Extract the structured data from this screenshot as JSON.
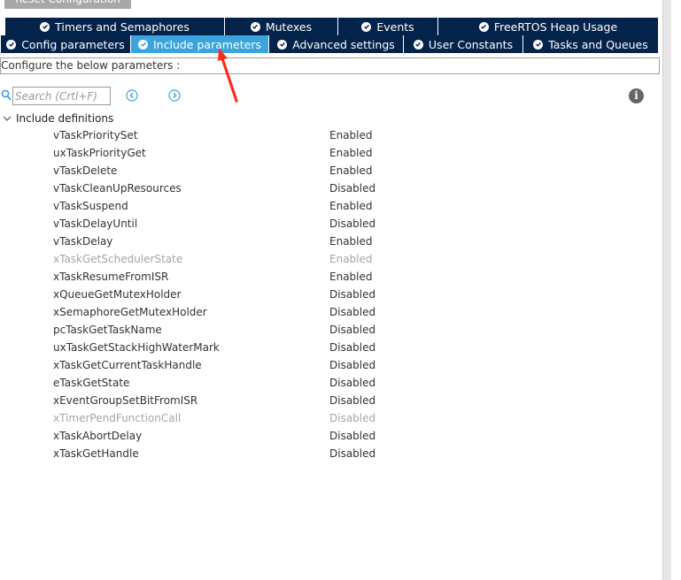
{
  "top_button": {
    "label": "Reset Configuration"
  },
  "tabs_row1": [
    {
      "label": "Timers and Semaphores",
      "active": false
    },
    {
      "label": "Mutexes",
      "active": false
    },
    {
      "label": "Events",
      "active": false
    },
    {
      "label": "FreeRTOS Heap Usage",
      "active": false
    }
  ],
  "tabs_row2": [
    {
      "label": "Config parameters",
      "active": false
    },
    {
      "label": "Include parameters",
      "active": true
    },
    {
      "label": "Advanced settings",
      "active": false
    },
    {
      "label": "User Constants",
      "active": false
    },
    {
      "label": "Tasks and Queues",
      "active": false
    }
  ],
  "section_label": "Configure the below parameters :",
  "search": {
    "placeholder": "Search (Crtl+F)",
    "value": ""
  },
  "info_icon": "i",
  "tree": {
    "group_label": "Include definitions",
    "expanded": true,
    "items": [
      {
        "name": "vTaskPrioritySet",
        "value": "Enabled",
        "dim": false
      },
      {
        "name": "uxTaskPriorityGet",
        "value": "Enabled",
        "dim": false
      },
      {
        "name": "vTaskDelete",
        "value": "Enabled",
        "dim": false
      },
      {
        "name": "vTaskCleanUpResources",
        "value": "Disabled",
        "dim": false
      },
      {
        "name": "vTaskSuspend",
        "value": "Enabled",
        "dim": false
      },
      {
        "name": "vTaskDelayUntil",
        "value": "Disabled",
        "dim": false
      },
      {
        "name": "vTaskDelay",
        "value": "Enabled",
        "dim": false
      },
      {
        "name": "xTaskGetSchedulerState",
        "value": "Enabled",
        "dim": true
      },
      {
        "name": "xTaskResumeFromISR",
        "value": "Enabled",
        "dim": false
      },
      {
        "name": "xQueueGetMutexHolder",
        "value": "Disabled",
        "dim": false
      },
      {
        "name": "xSemaphoreGetMutexHolder",
        "value": "Disabled",
        "dim": false
      },
      {
        "name": "pcTaskGetTaskName",
        "value": "Disabled",
        "dim": false
      },
      {
        "name": "uxTaskGetStackHighWaterMark",
        "value": "Disabled",
        "dim": false
      },
      {
        "name": "xTaskGetCurrentTaskHandle",
        "value": "Disabled",
        "dim": false
      },
      {
        "name": "eTaskGetState",
        "value": "Disabled",
        "dim": false
      },
      {
        "name": "xEventGroupSetBitFromISR",
        "value": "Disabled",
        "dim": false
      },
      {
        "name": "xTimerPendFunctionCall",
        "value": "Disabled",
        "dim": true
      },
      {
        "name": "xTaskAbortDelay",
        "value": "Disabled",
        "dim": false
      },
      {
        "name": "xTaskGetHandle",
        "value": "Disabled",
        "dim": false
      }
    ]
  },
  "colors": {
    "tab_bg": "#03234b",
    "tab_active_bg": "#3ca4dc",
    "dim_text": "#a5a5a5",
    "arrow_annotation": "#ff2a1a",
    "nav_arrow": "#3ca4dc"
  }
}
